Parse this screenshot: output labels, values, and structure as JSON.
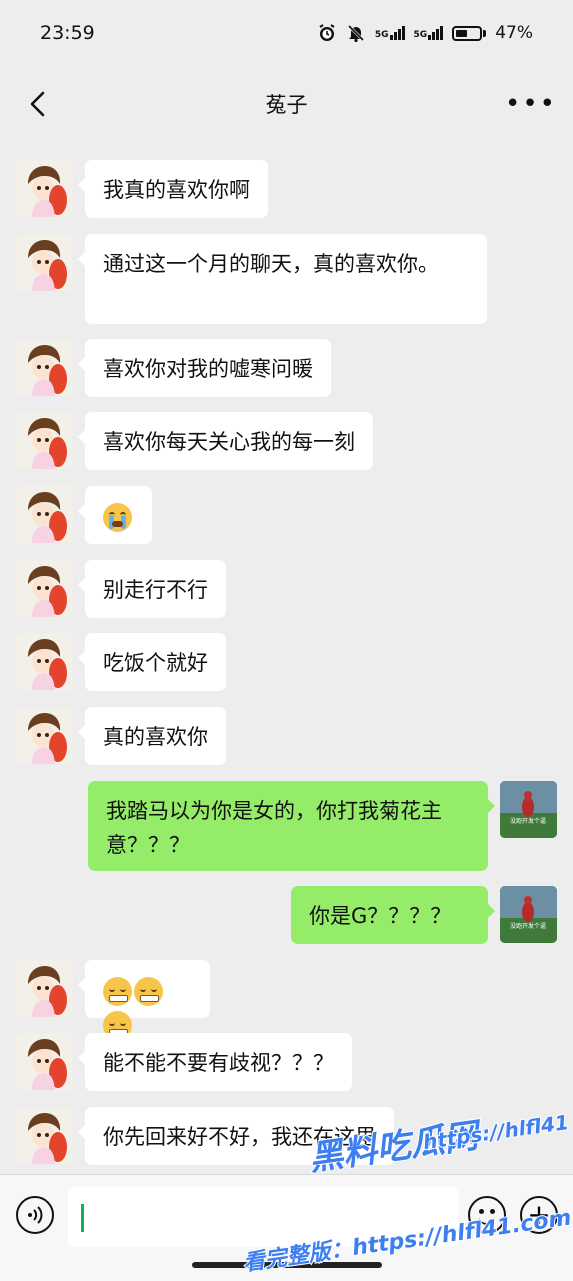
{
  "status_bar": {
    "time": "23:59",
    "battery_percent": "47%",
    "battery_level": 0.47,
    "signal_1_label": "5G",
    "signal_2_label": "5G",
    "icons": [
      "alarm-icon",
      "mute-bell-icon",
      "signal-icon",
      "signal-icon",
      "battery-icon"
    ]
  },
  "nav": {
    "title": "菟子",
    "back_icon": "chevron-left-icon",
    "more_label": "•••"
  },
  "messages": [
    {
      "side": "left",
      "text": "我真的喜欢你啊"
    },
    {
      "side": "left",
      "text": "通过这一个月的聊天，真的喜欢你。"
    },
    {
      "side": "left",
      "text": "喜欢你对我的嘘寒问暖"
    },
    {
      "side": "left",
      "text": "喜欢你每天关心我的每一刻"
    },
    {
      "side": "left",
      "emoji": "crying-face"
    },
    {
      "side": "left",
      "text": "别走行不行"
    },
    {
      "side": "left",
      "text": "吃饭个就好"
    },
    {
      "side": "left",
      "text": "真的喜欢你"
    },
    {
      "side": "right",
      "text": "我踏马以为你是女的，你打我菊花主意？？？"
    },
    {
      "side": "right",
      "text": "你是G？？？？"
    },
    {
      "side": "left",
      "emoji": "zipper-mouth-face x3"
    },
    {
      "side": "left",
      "text": "能不能不要有歧视？？？"
    },
    {
      "side": "left",
      "text": "你先回来好不好，我还在这里"
    }
  ],
  "avatar_right_caption": "没跑开发个逼",
  "input_bar": {
    "voice_icon": "voice-icon",
    "emoji_icon": "emoji-icon",
    "plus_label": "+"
  },
  "watermark": {
    "line1": "黑料吃瓜网",
    "line2": "https://hlfl41.com",
    "line3": "看完整版：https://hlfl41.com",
    "colors": {
      "fill": "#3d7ff0",
      "outline": "#ffffff"
    }
  }
}
